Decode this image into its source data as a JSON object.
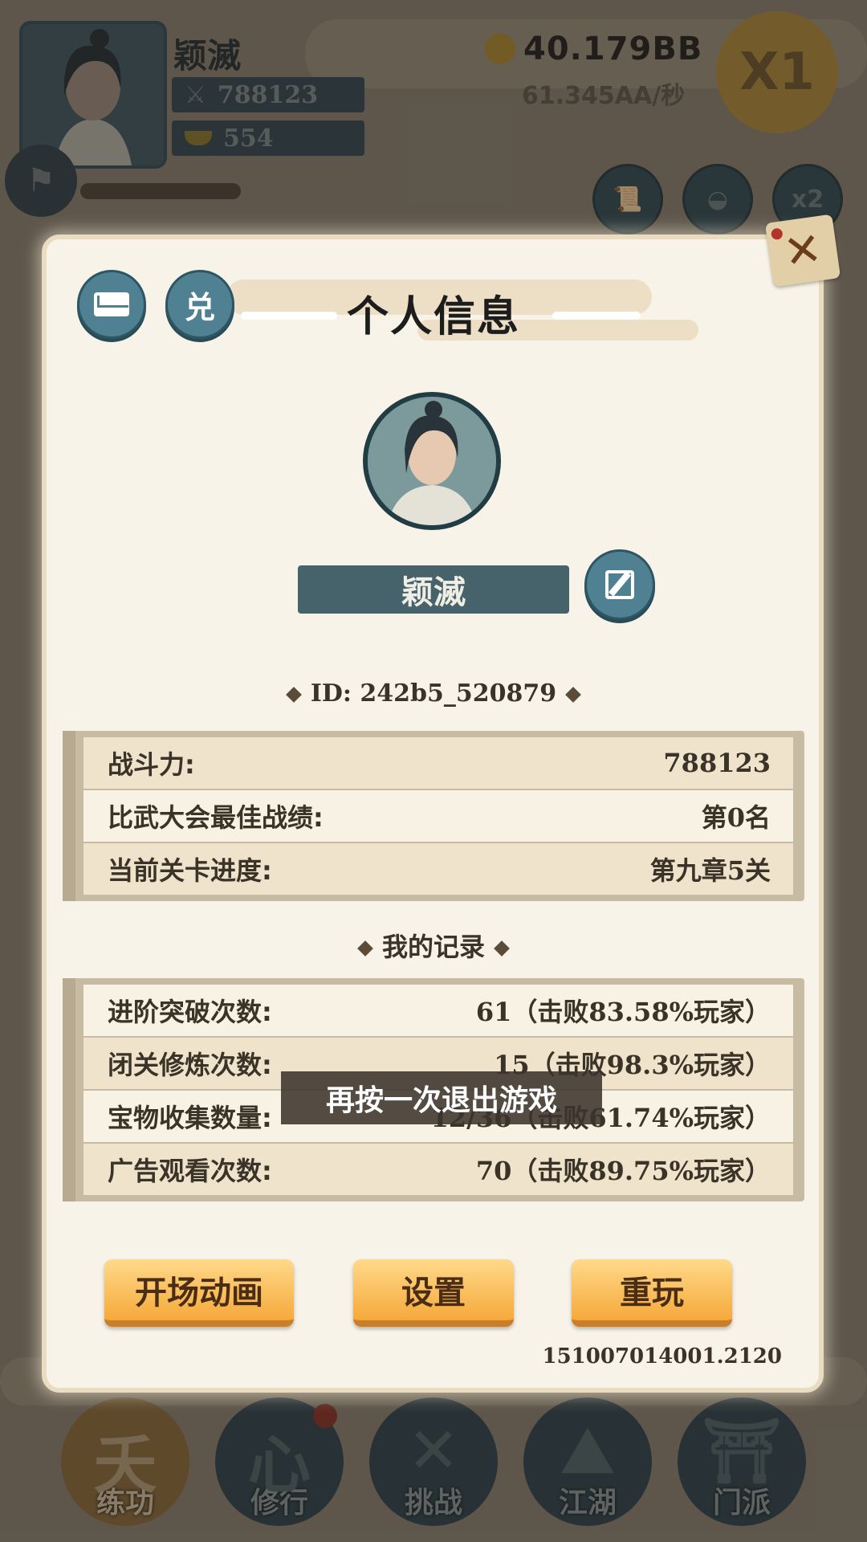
{
  "hud": {
    "player_name": "颖滅",
    "combat_power": "788123",
    "ingots": "554",
    "gold": "40.179BB",
    "gold_rate": "61.345AA/秒",
    "speed": "X1",
    "round_buttons": [
      "任务",
      "日菜",
      "x2"
    ]
  },
  "modal": {
    "title": "个人信息",
    "redeem_label": "兑",
    "name": "颖滅",
    "id_line": "ID: 242b5_520879",
    "stats": [
      {
        "label": "战斗力:",
        "value": "788123"
      },
      {
        "label": "比武大会最佳战绩:",
        "value": "第0名"
      },
      {
        "label": "当前关卡进度:",
        "value": "第九章5关"
      }
    ],
    "records_title": "我的记录",
    "records": [
      {
        "label": "进阶突破次数:",
        "value": "61（击败83.58%玩家）"
      },
      {
        "label": "闭关修炼次数:",
        "value": "15（击败98.3%玩家）"
      },
      {
        "label": "宝物收集数量:",
        "value": "12/36（击败61.74%玩家）"
      },
      {
        "label": "广告观看次数:",
        "value": "70（击败89.75%玩家）"
      }
    ],
    "buttons": {
      "intro": "开场动画",
      "settings": "设置",
      "replay": "重玩"
    },
    "version": "151007014001.2120"
  },
  "toast": "再按一次退出游戏",
  "nav": [
    {
      "label": "练功",
      "glyph": "夭"
    },
    {
      "label": "修行",
      "glyph": "心"
    },
    {
      "label": "挑战",
      "glyph": "✕"
    },
    {
      "label": "江湖",
      "glyph": "⛰"
    },
    {
      "label": "门派",
      "glyph": "⛩"
    }
  ],
  "colors": {
    "accent_teal": "#4f8192",
    "button_orange": "#f5a93a",
    "panel": "#f8f3e8"
  }
}
